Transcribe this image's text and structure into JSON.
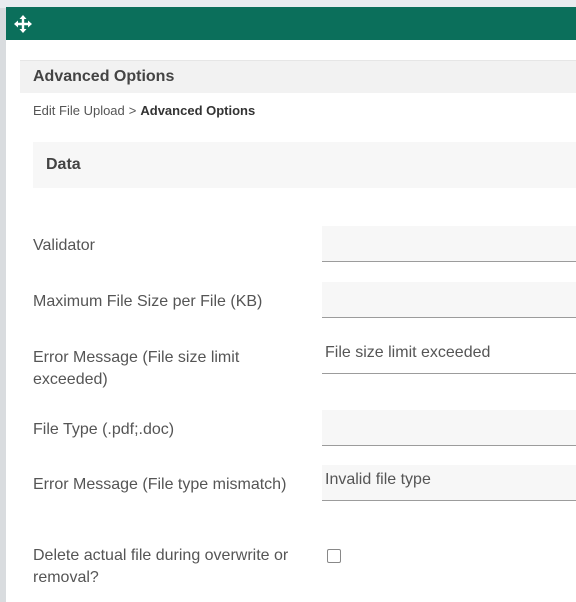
{
  "dialog": {
    "header_title": "Advanced Options",
    "breadcrumb": {
      "parent": "Edit File Upload",
      "separator": ">",
      "current": "Advanced Options"
    },
    "section_title": "Data"
  },
  "fields": {
    "validator": {
      "label": "Validator",
      "value": ""
    },
    "max_size": {
      "label": "Maximum File Size per File (KB)",
      "value": ""
    },
    "size_error": {
      "label": "Error Message (File size limit exceeded)",
      "value": "File size limit exceeded"
    },
    "file_type": {
      "label": "File Type (.pdf;.doc)",
      "value": ""
    },
    "type_error": {
      "label": "Error Message (File type mismatch)",
      "value": "Invalid file type"
    },
    "delete_file": {
      "label": "Delete actual file during overwrite or removal?",
      "checked": false
    }
  },
  "icons": {
    "move": "move-icon"
  },
  "colors": {
    "titlebar": "#0b6f5b"
  }
}
